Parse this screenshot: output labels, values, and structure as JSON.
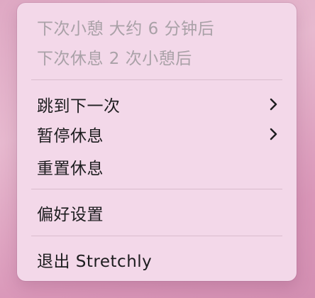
{
  "menu": {
    "status_next_break": "下次小憩 大约 6 分钟后",
    "status_next_long_break": "下次休息 2 次小憩后",
    "skip_to_next": "跳到下一次",
    "pause_breaks": "暂停休息",
    "reset_breaks": "重置休息",
    "preferences": "偏好设置",
    "quit": "退出 Stretchly"
  },
  "icons": {
    "submenu": "chevron-right-icon"
  },
  "colors": {
    "menu_background": "#f3d8e9",
    "text": "#1d1d1f",
    "disabled_text": "#a9a1a7",
    "separator": "#d9bccd"
  }
}
